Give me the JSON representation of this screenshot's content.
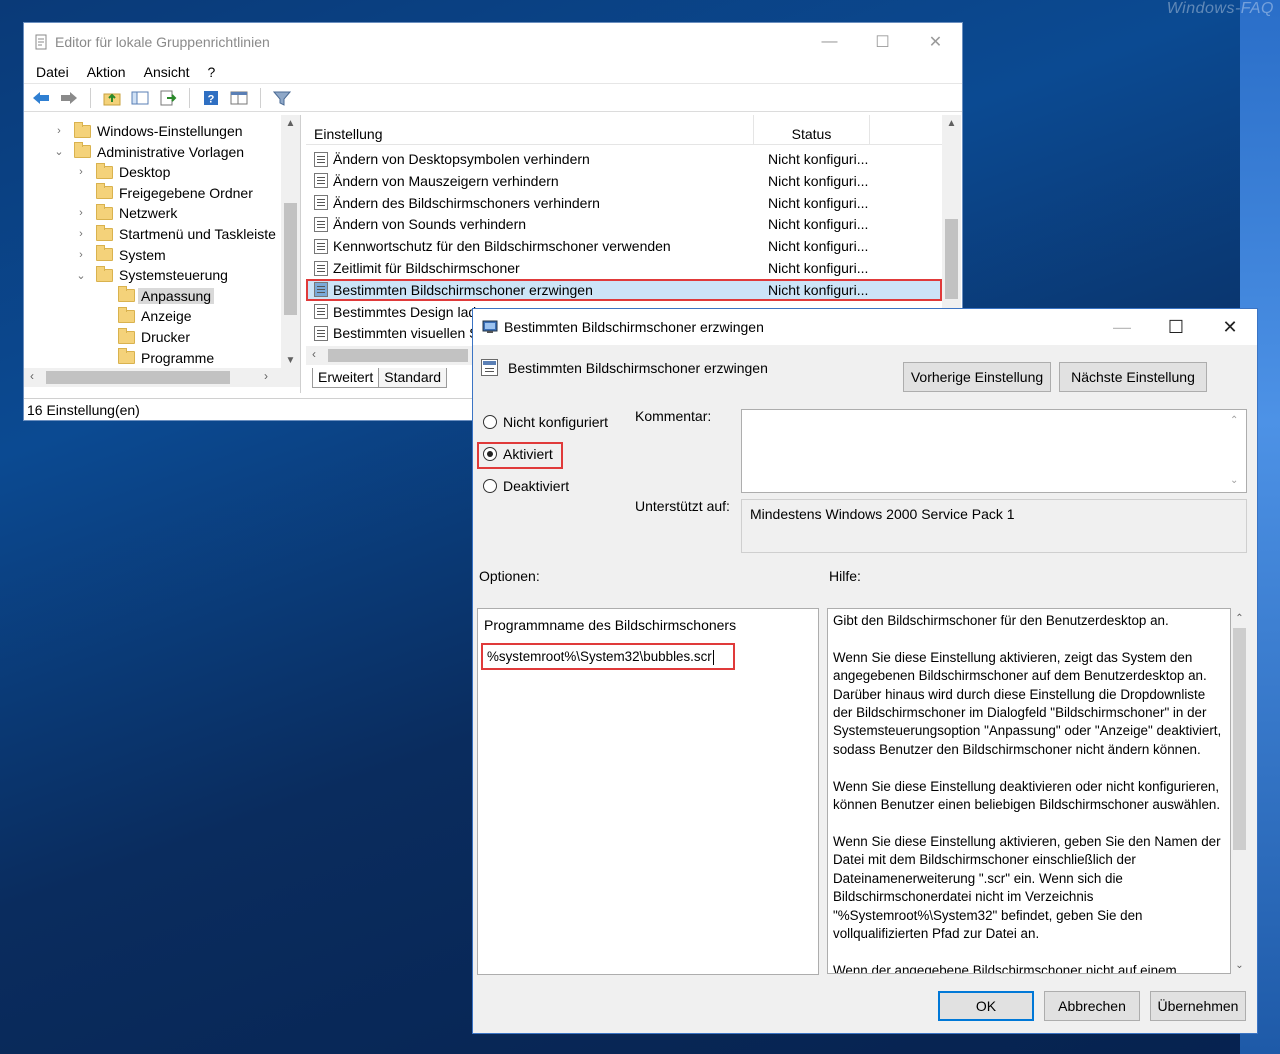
{
  "watermark": "Windows-FAQ",
  "gpo": {
    "title": "Editor für lokale Gruppenrichtlinien",
    "menu": [
      "Datei",
      "Aktion",
      "Ansicht",
      "?"
    ],
    "tree": [
      {
        "label": "Windows-Einstellungen",
        "arrow": "›",
        "level": 0
      },
      {
        "label": "Administrative Vorlagen",
        "arrow": "⌄",
        "level": 0
      },
      {
        "label": "Desktop",
        "arrow": "›",
        "level": 1
      },
      {
        "label": "Freigegebene Ordner",
        "arrow": "",
        "level": 1
      },
      {
        "label": "Netzwerk",
        "arrow": "›",
        "level": 1
      },
      {
        "label": "Startmenü und Taskleiste",
        "arrow": "›",
        "level": 1
      },
      {
        "label": "System",
        "arrow": "›",
        "level": 1
      },
      {
        "label": "Systemsteuerung",
        "arrow": "⌄",
        "level": 1
      },
      {
        "label": "Anpassung",
        "arrow": "",
        "level": 2,
        "selected": true
      },
      {
        "label": "Anzeige",
        "arrow": "",
        "level": 2
      },
      {
        "label": "Drucker",
        "arrow": "",
        "level": 2
      },
      {
        "label": "Programme",
        "arrow": "",
        "level": 2
      }
    ],
    "columns": {
      "setting": "Einstellung",
      "status": "Status"
    },
    "rows": [
      {
        "name": "Ändern von Desktopsymbolen verhindern",
        "status": "Nicht konfiguri..."
      },
      {
        "name": "Ändern von Mauszeigern verhindern",
        "status": "Nicht konfiguri..."
      },
      {
        "name": "Ändern des Bildschirmschoners verhindern",
        "status": "Nicht konfiguri..."
      },
      {
        "name": "Ändern von Sounds verhindern",
        "status": "Nicht konfiguri..."
      },
      {
        "name": "Kennwortschutz für den Bildschirmschoner verwenden",
        "status": "Nicht konfiguri..."
      },
      {
        "name": "Zeitlimit für Bildschirmschoner",
        "status": "Nicht konfiguri..."
      },
      {
        "name": "Bestimmten Bildschirmschoner erzwingen",
        "status": "Nicht konfiguri...",
        "selected": true
      },
      {
        "name": "Bestimmtes Design laden",
        "status": ""
      },
      {
        "name": "Bestimmten visuellen Stil",
        "status": ""
      }
    ],
    "tabs": [
      "Erweitert",
      "Standard"
    ],
    "status_bar": "16 Einstellung(en)"
  },
  "dialog": {
    "title": "Bestimmten Bildschirmschoner erzwingen",
    "header": "Bestimmten Bildschirmschoner erzwingen",
    "prev_button": "Vorherige Einstellung",
    "next_button": "Nächste Einstellung",
    "radio_not_configured": "Nicht konfiguriert",
    "radio_enabled": "Aktiviert",
    "radio_disabled": "Deaktiviert",
    "selected_radio": "enabled",
    "comment_label": "Kommentar:",
    "comment_value": "",
    "supported_label": "Unterstützt auf:",
    "supported_value": "Mindestens Windows 2000 Service Pack 1",
    "options_label": "Optionen:",
    "help_label": "Hilfe:",
    "option_field_label": "Programmname des Bildschirmschoners",
    "option_field_value": "%systemroot%\\System32\\bubbles.scr",
    "help_text": "Gibt den Bildschirmschoner für den Benutzerdesktop an.\n\nWenn Sie diese Einstellung aktivieren, zeigt das System den angegebenen Bildschirmschoner auf dem Benutzerdesktop an. Darüber hinaus wird durch diese Einstellung die Dropdownliste der Bildschirmschoner im Dialogfeld \"Bildschirmschoner\" in der Systemsteuerungsoption \"Anpassung\" oder \"Anzeige\" deaktiviert, sodass Benutzer den Bildschirmschoner nicht ändern können.\n\nWenn Sie diese Einstellung deaktivieren oder nicht konfigurieren, können Benutzer einen beliebigen Bildschirmschoner auswählen.\n\nWenn Sie diese Einstellung aktivieren, geben Sie den Namen der Datei mit dem Bildschirmschoner einschließlich der Dateinamenerweiterung \".scr\" ein. Wenn sich die Bildschirmschonerdatei nicht im Verzeichnis \"%Systemroot%\\System32\" befindet, geben Sie den vollqualifizierten Pfad zur Datei an.\n\nWenn der angegebene Bildschirmschoner nicht auf einem",
    "ok_button": "OK",
    "cancel_button": "Abbrechen",
    "apply_button": "Übernehmen"
  },
  "colors": {
    "highlight_red": "#e03a3a",
    "selection_blue": "#cce4f7",
    "accent": "#0078d7"
  }
}
